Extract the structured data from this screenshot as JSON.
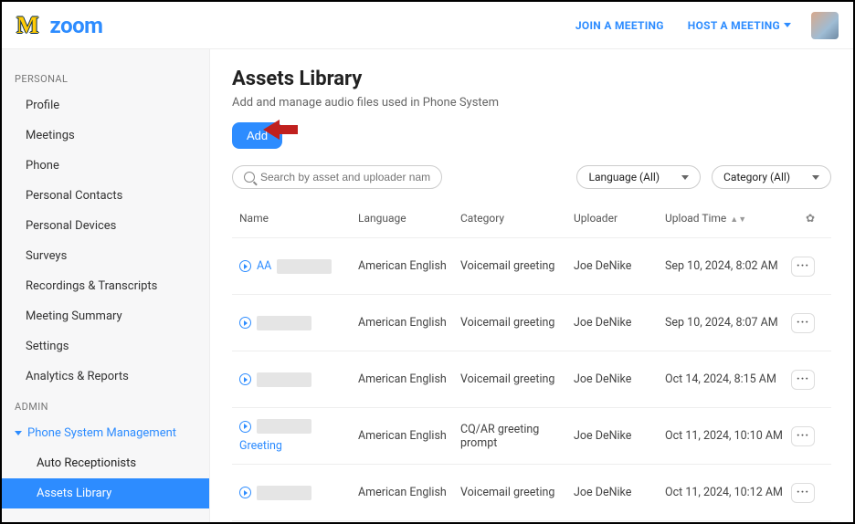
{
  "header": {
    "logo_m": "M",
    "logo_zoom": "zoom",
    "join": "JOIN A MEETING",
    "host": "HOST A MEETING"
  },
  "sidebar": {
    "personal_label": "PERSONAL",
    "personal": [
      "Profile",
      "Meetings",
      "Phone",
      "Personal Contacts",
      "Personal Devices",
      "Surveys",
      "Recordings & Transcripts",
      "Meeting Summary",
      "Settings",
      "Analytics & Reports"
    ],
    "admin_label": "ADMIN",
    "admin_parent": "Phone System Management",
    "admin_children": [
      {
        "label": "Auto Receptionists",
        "active": false
      },
      {
        "label": "Assets Library",
        "active": true
      }
    ]
  },
  "page": {
    "title": "Assets Library",
    "subtitle": "Add and manage audio files used in Phone System",
    "add": "Add",
    "search_placeholder": "Search by asset and uploader name",
    "lang_filter": "Language (All)",
    "cat_filter": "Category (All)"
  },
  "table": {
    "headers": {
      "name": "Name",
      "language": "Language",
      "category": "Category",
      "uploader": "Uploader",
      "upload_time": "Upload Time"
    },
    "rows": [
      {
        "name_prefix": "AA",
        "name_extra": "",
        "language": "American English",
        "category": "Voicemail greeting",
        "uploader": "Joe DeNike",
        "time": "Sep 10, 2024, 8:02 AM"
      },
      {
        "name_prefix": "",
        "name_extra": "",
        "language": "American English",
        "category": "Voicemail greeting",
        "uploader": "Joe DeNike",
        "time": "Sep 10, 2024, 8:07 AM"
      },
      {
        "name_prefix": "",
        "name_extra": "",
        "language": "American English",
        "category": "Voicemail greeting",
        "uploader": "Joe DeNike",
        "time": "Oct 14, 2024, 8:15 AM"
      },
      {
        "name_prefix": "",
        "name_extra": "Greeting",
        "language": "American English",
        "category": "CQ/AR greeting prompt",
        "uploader": "Joe DeNike",
        "time": "Oct 11, 2024, 10:10 AM"
      },
      {
        "name_prefix": "",
        "name_extra": "",
        "language": "American English",
        "category": "Voicemail greeting",
        "uploader": "Joe DeNike",
        "time": "Oct 11, 2024, 10:12 AM"
      }
    ]
  }
}
